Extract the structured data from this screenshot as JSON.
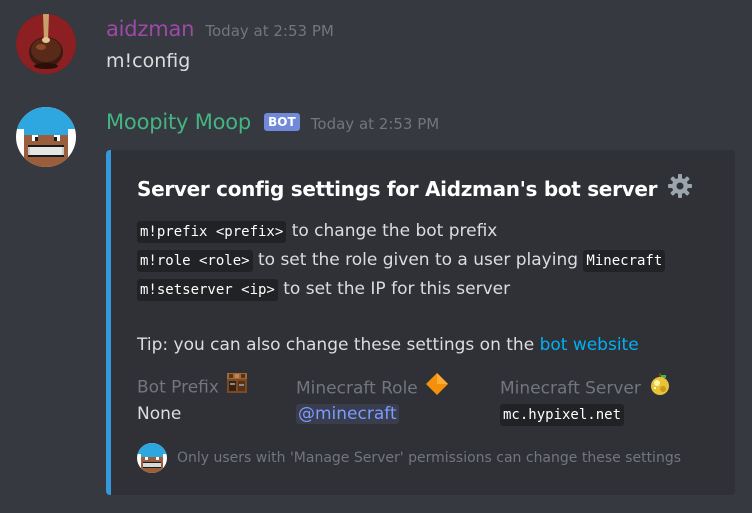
{
  "messages": [
    {
      "username": "aidzman",
      "username_color": "#9c4aa8",
      "timestamp": "Today at 2:53 PM",
      "content": "m!config"
    },
    {
      "username": "Moopity Moop",
      "username_color": "#43b581",
      "bot_tag": "BOT",
      "timestamp": "Today at 2:53 PM"
    }
  ],
  "embed": {
    "accent_color": "#3498db",
    "title": "Server config settings for Aidzman's bot server",
    "title_icon": "gear-icon",
    "lines": [
      {
        "code": "m!prefix <prefix>",
        "text": " to change the bot prefix"
      },
      {
        "code": "m!role <role>",
        "text": " to set the role given to a user playing ",
        "code2": "Minecraft"
      },
      {
        "code": "m!setserver <ip>",
        "text": " to set the IP for this server"
      }
    ],
    "tip_text": "Tip: you can also change these settings on the ",
    "tip_link": "bot website",
    "fields": [
      {
        "name": "Bot Prefix",
        "icon": "crafting-table-icon",
        "value": "None"
      },
      {
        "name": "Minecraft Role",
        "icon": "orange-diamond-icon",
        "value": "@minecraft"
      },
      {
        "name": "Minecraft Server",
        "icon": "golden-apple-icon",
        "value": "mc.hypixel.net"
      }
    ],
    "footer_text": "Only users with 'Manage Server' permissions can change these settings"
  }
}
